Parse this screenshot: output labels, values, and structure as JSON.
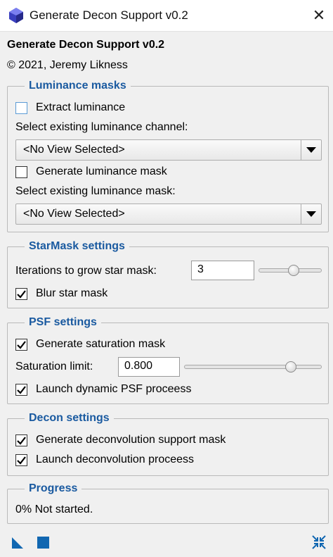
{
  "window": {
    "title": "Generate Decon Support v0.2",
    "close_label": "✕"
  },
  "header": {
    "title": "Generate Decon Support v0.2",
    "copyright": "© 2021, Jeremy Likness"
  },
  "luminance": {
    "title": "Luminance masks",
    "extract_label": "Extract luminance",
    "extract_checked": false,
    "select_channel_label": "Select existing luminance channel:",
    "channel_value": "<No View Selected>",
    "generate_mask_label": "Generate luminance mask",
    "generate_mask_checked": false,
    "select_mask_label": "Select existing luminance mask:",
    "mask_value": "<No View Selected>"
  },
  "starmask": {
    "title": "StarMask settings",
    "iterations_label": "Iterations to grow star mask:",
    "iterations_value": "3",
    "iterations_slider_fraction": 0.57,
    "blur_label": "Blur star mask",
    "blur_checked": true
  },
  "psf": {
    "title": "PSF settings",
    "saturation_mask_label": "Generate saturation mask",
    "saturation_mask_checked": true,
    "saturation_limit_label": "Saturation limit:",
    "saturation_limit_value": "0.800",
    "saturation_slider_fraction": 0.8,
    "launch_psf_label": "Launch dynamic PSF proceess",
    "launch_psf_checked": true
  },
  "decon": {
    "title": "Decon settings",
    "support_mask_label": "Generate deconvolution support mask",
    "support_mask_checked": true,
    "launch_decon_label": "Launch deconvolution proceess",
    "launch_decon_checked": true
  },
  "progress": {
    "title": "Progress",
    "status": "0% Not started."
  },
  "toolbar": {
    "execute_icon": "new-instance-triangle-icon",
    "apply_icon": "apply-square-icon",
    "reset_icon": "collapse-arrows-icon"
  },
  "colors": {
    "accent": "#1a5aa0",
    "icon_blue": "#1167b1"
  }
}
